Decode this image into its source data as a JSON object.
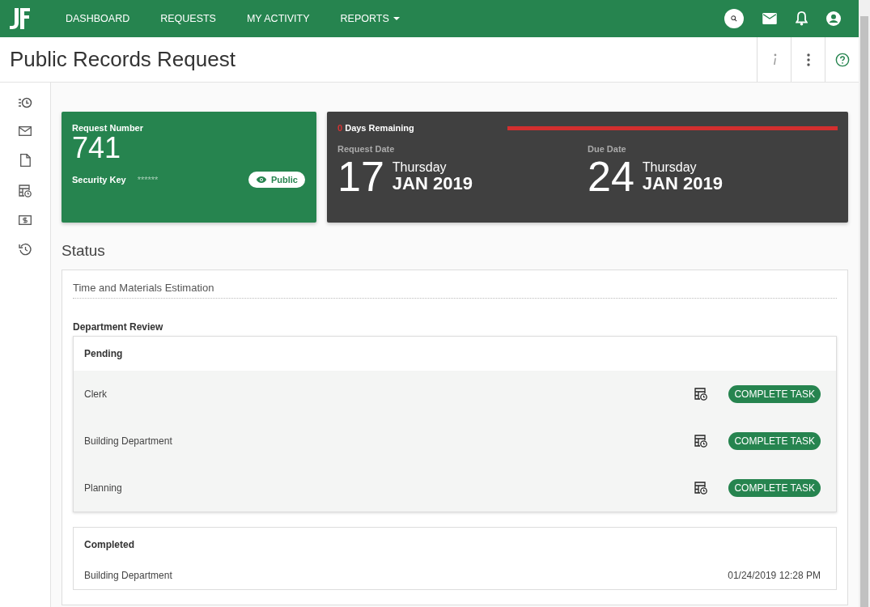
{
  "nav": {
    "items": [
      {
        "label": "DASHBOARD",
        "has_menu": false
      },
      {
        "label": "REQUESTS",
        "has_menu": false
      },
      {
        "label": "MY ACTIVITY",
        "has_menu": false
      },
      {
        "label": "REPORTS",
        "has_menu": true
      }
    ]
  },
  "page": {
    "title": "Public Records Request"
  },
  "request_card": {
    "label": "Request Number",
    "number": "741",
    "security_label": "Security Key",
    "security_value": "******",
    "visibility": "Public"
  },
  "dates_card": {
    "days_count": "0",
    "days_label": "Days Remaining",
    "level": 1,
    "dates": [
      {
        "label": "Request Date",
        "day": "17",
        "weekday": "Thursday",
        "month_year": "JAN 2019"
      },
      {
        "label": "Due Date",
        "day": "24",
        "weekday": "Thursday",
        "month_year": "JAN 2019"
      }
    ]
  },
  "status": {
    "title": "Status",
    "estimation": "Time and Materials Estimation",
    "section": "Department Review",
    "groups": [
      {
        "title": "Pending",
        "kind": "pending",
        "tasks": [
          {
            "name": "Clerk",
            "action": "COMPLETE TASK"
          },
          {
            "name": "Building Department",
            "action": "COMPLETE TASK"
          },
          {
            "name": "Planning",
            "action": "COMPLETE TASK"
          }
        ]
      },
      {
        "title": "Completed",
        "kind": "completed",
        "tasks": [
          {
            "name": "Building Department",
            "time": "01/24/2019 12:28 PM"
          }
        ]
      }
    ]
  }
}
